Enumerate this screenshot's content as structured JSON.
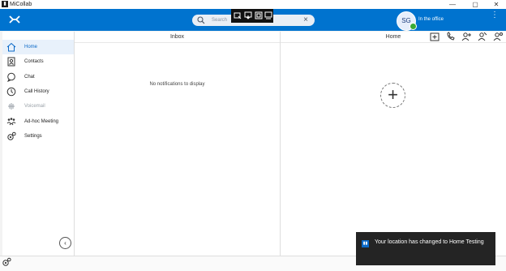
{
  "window": {
    "title": "MiCollab",
    "controls": {
      "minimize": "—",
      "maximize": "▢",
      "close": "✕"
    }
  },
  "topbar": {
    "brand_icon": "mitel-logo-icon",
    "search": {
      "placeholder": "Search"
    },
    "avatar_initials": "SG",
    "presence_status": "In the office",
    "more": "⋮"
  },
  "overlay_toolbar": {
    "icons": [
      "capture-icon",
      "cast-icon",
      "screen-icon",
      "settings-icon"
    ]
  },
  "sidebar": {
    "items": [
      {
        "label": "Home",
        "icon": "home-icon",
        "active": true,
        "disabled": false
      },
      {
        "label": "Contacts",
        "icon": "contacts-icon",
        "active": false,
        "disabled": false
      },
      {
        "label": "Chat",
        "icon": "chat-icon",
        "active": false,
        "disabled": false
      },
      {
        "label": "Call History",
        "icon": "clock-icon",
        "active": false,
        "disabled": false
      },
      {
        "label": "Voicemail",
        "icon": "voicemail-icon",
        "active": false,
        "disabled": true
      },
      {
        "label": "Ad-hoc Meeting",
        "icon": "meeting-icon",
        "active": false,
        "disabled": false
      },
      {
        "label": "Settings",
        "icon": "gear-icon",
        "active": false,
        "disabled": false
      }
    ],
    "collapse": "‹"
  },
  "inbox": {
    "title": "Inbox",
    "empty_message": "No notifications to display"
  },
  "home": {
    "title": "Home",
    "tool_icons": [
      "add-tab-icon",
      "call-icon",
      "add-contact-icon",
      "presence-icon",
      "status-icon"
    ],
    "add_widget": "+"
  },
  "toast": {
    "message": "Your location has changed to Home Testing"
  },
  "colors": {
    "accent": "#0073cf",
    "active_nav_bg": "#e8f1fb",
    "presence": "#3aaa35"
  }
}
